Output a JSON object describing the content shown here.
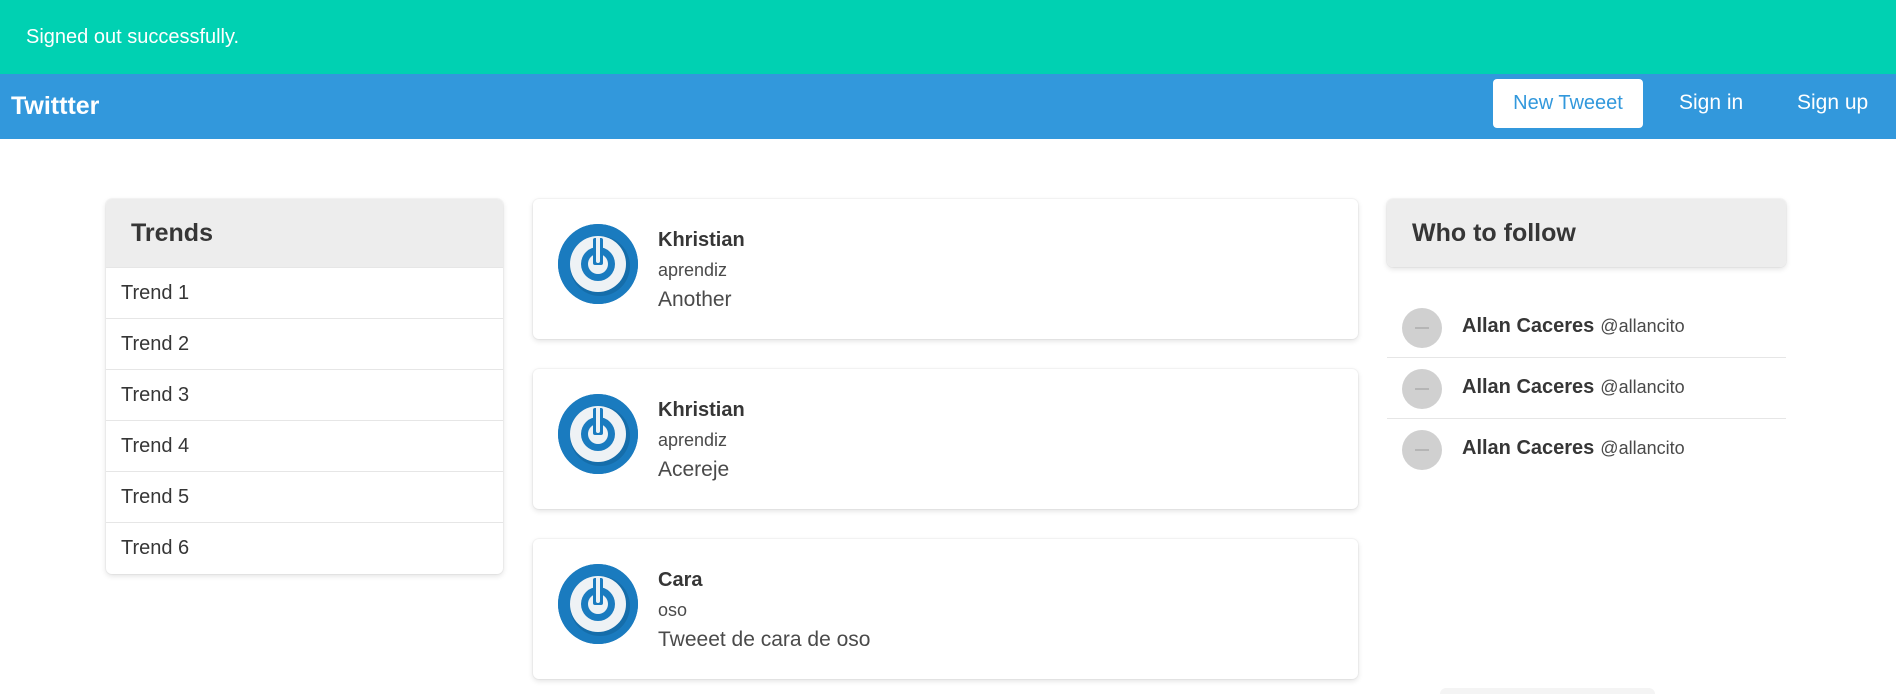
{
  "notification": {
    "text": "Signed out successfully.",
    "color": "#00d1b2"
  },
  "navbar": {
    "brand": "Twittter",
    "new_tweet_label": "New Tweeet",
    "sign_in_label": "Sign in",
    "sign_up_label": "Sign up",
    "color": "#3298dc"
  },
  "trends": {
    "title": "Trends",
    "items": [
      "Trend 1",
      "Trend 2",
      "Trend 3",
      "Trend 4",
      "Trend 5",
      "Trend 6"
    ]
  },
  "tweets": [
    {
      "name": "Khristian",
      "handle": "aprendiz",
      "text": "Another",
      "avatar_icon": "power-icon"
    },
    {
      "name": "Khristian",
      "handle": "aprendiz",
      "text": "Acereje",
      "avatar_icon": "power-icon"
    },
    {
      "name": "Cara",
      "handle": "oso",
      "text": "Tweeet de cara de oso",
      "avatar_icon": "power-icon"
    }
  ],
  "who_to_follow": {
    "title": "Who to follow",
    "users": [
      {
        "name": "Allan Caceres",
        "handle": "@allancito"
      },
      {
        "name": "Allan Caceres",
        "handle": "@allancito"
      },
      {
        "name": "Allan Caceres",
        "handle": "@allancito"
      }
    ]
  }
}
